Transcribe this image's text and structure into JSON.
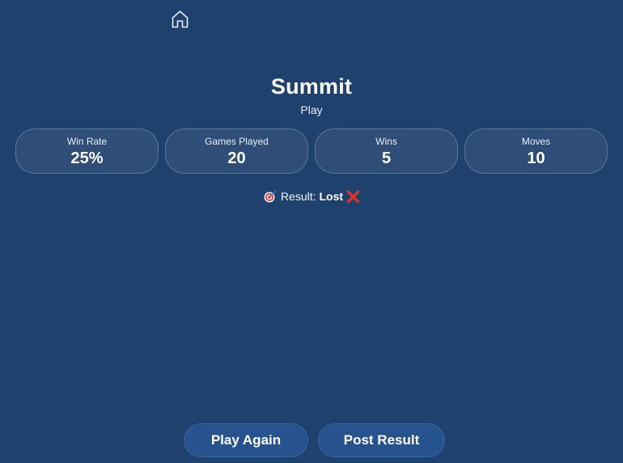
{
  "header": {
    "home_icon": "home-icon"
  },
  "game": {
    "title": "Summit",
    "mode": "Play"
  },
  "stats": [
    {
      "label": "Win Rate",
      "value": "25%"
    },
    {
      "label": "Games Played",
      "value": "20"
    },
    {
      "label": "Wins",
      "value": "5"
    },
    {
      "label": "Moves",
      "value": "10"
    }
  ],
  "result": {
    "prefix_icon": "target-icon",
    "label": "Result:",
    "outcome": "Lost",
    "outcome_icon": "cross-mark-icon"
  },
  "actions": {
    "play_again_label": "Play Again",
    "post_result_label": "Post Result"
  },
  "colors": {
    "background": "#1f416d",
    "button": "#26538e",
    "loss_mark": "#d9342b"
  }
}
